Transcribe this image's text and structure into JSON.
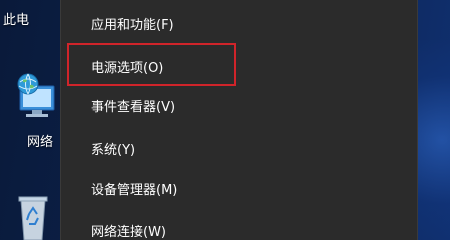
{
  "desktop": {
    "icons": [
      {
        "label": "此电",
        "icon": "this-pc-icon"
      },
      {
        "label": "网络",
        "icon": "network-icon"
      },
      {
        "label": "",
        "icon": "recycle-bin-icon"
      }
    ]
  },
  "menu": {
    "items": [
      {
        "label": "应用和功能(F)"
      },
      {
        "label": "电源选项(O)",
        "highlighted": true
      },
      {
        "label": "事件查看器(V)"
      },
      {
        "label": "系统(Y)"
      },
      {
        "label": "设备管理器(M)"
      },
      {
        "label": "网络连接(W)"
      }
    ]
  },
  "colors": {
    "menu_background": "#2b2b2b",
    "highlight_border": "#d0242a",
    "desktop_background": "#0c2350"
  }
}
